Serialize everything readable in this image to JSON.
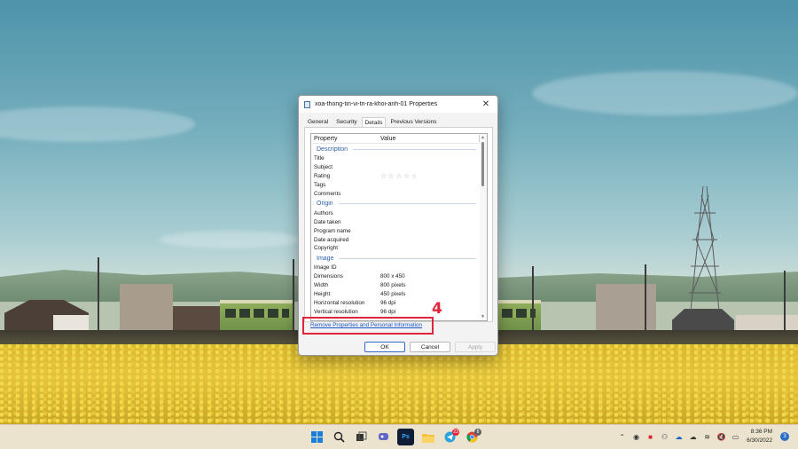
{
  "window": {
    "title": "xoa-thong-tin-vi-tri-ra-khoi-anh-01 Properties",
    "close_glyph": "✕"
  },
  "tabs": [
    {
      "label": "General"
    },
    {
      "label": "Security"
    },
    {
      "label": "Details",
      "active": true
    },
    {
      "label": "Previous Versions"
    }
  ],
  "list": {
    "header": {
      "property": "Property",
      "value": "Value"
    },
    "sections": {
      "description": {
        "label": "Description",
        "rows": [
          {
            "k": "Title",
            "v": ""
          },
          {
            "k": "Subject",
            "v": ""
          },
          {
            "k": "Rating",
            "v": "☆☆☆☆☆"
          },
          {
            "k": "Tags",
            "v": ""
          },
          {
            "k": "Comments",
            "v": ""
          }
        ]
      },
      "origin": {
        "label": "Origin",
        "rows": [
          {
            "k": "Authors",
            "v": ""
          },
          {
            "k": "Date taken",
            "v": ""
          },
          {
            "k": "Program name",
            "v": ""
          },
          {
            "k": "Date acquired",
            "v": ""
          },
          {
            "k": "Copyright",
            "v": ""
          }
        ]
      },
      "image": {
        "label": "Image",
        "rows": [
          {
            "k": "Image ID",
            "v": ""
          },
          {
            "k": "Dimensions",
            "v": "800 x 450"
          },
          {
            "k": "Width",
            "v": "800 pixels"
          },
          {
            "k": "Height",
            "v": "450 pixels"
          },
          {
            "k": "Horizontal resolution",
            "v": "96 dpi"
          },
          {
            "k": "Vertical resolution",
            "v": "96 dpi"
          }
        ]
      }
    }
  },
  "remove_link": "Remove Properties and Personal Information",
  "annotation": {
    "step": "4",
    "color": "#e0243a"
  },
  "buttons": {
    "ok": "OK",
    "cancel": "Cancel",
    "apply": "Apply"
  },
  "taskbar": {
    "apps": [
      {
        "icon": "windows-start-icon"
      },
      {
        "icon": "search-icon"
      },
      {
        "icon": "task-view-icon"
      },
      {
        "icon": "chat-icon"
      },
      {
        "icon": "photoshop-icon",
        "text": "Ps"
      },
      {
        "icon": "file-explorer-icon"
      },
      {
        "icon": "telegram-icon",
        "badge": "23"
      },
      {
        "icon": "chrome-icon",
        "badge": "8"
      }
    ],
    "clock": {
      "time": "8:36 PM",
      "date": "6/30/2022"
    },
    "notifications": "3"
  }
}
